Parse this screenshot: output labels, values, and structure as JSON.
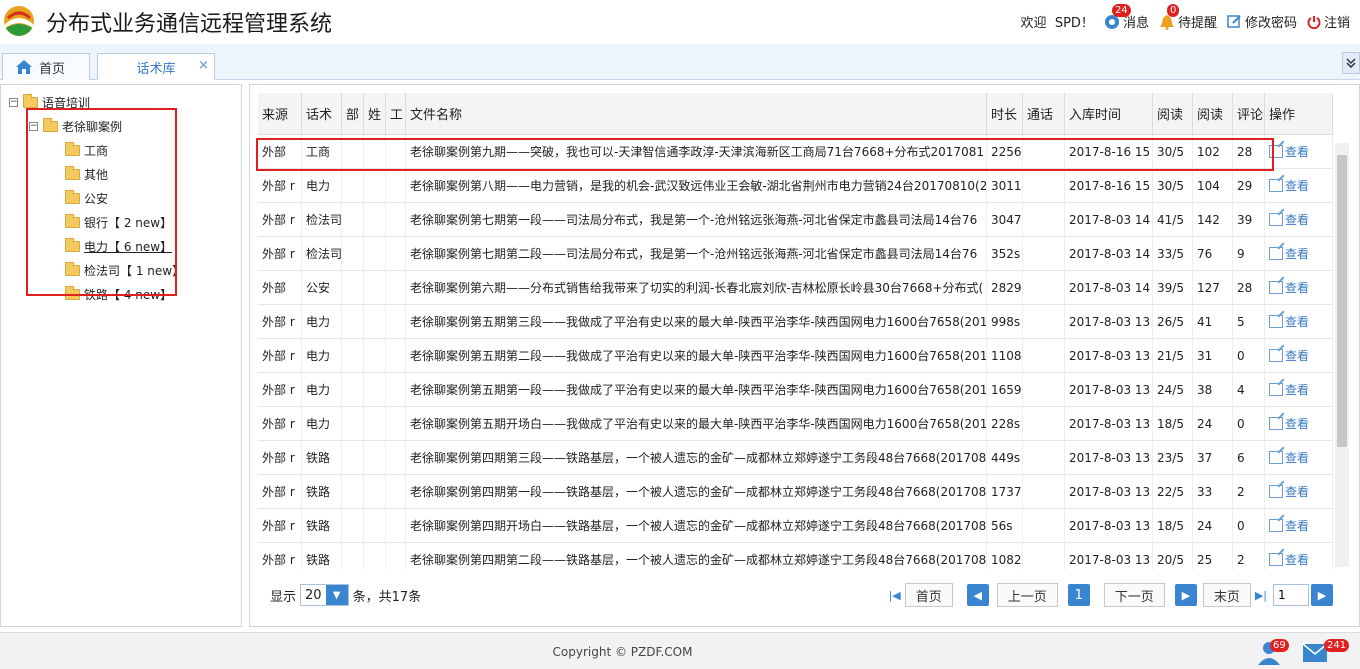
{
  "header": {
    "title": "分布式业务通信远程管理系统",
    "welcome": "欢迎",
    "user": "SPD！",
    "messages_label": "消息",
    "messages_count": "24",
    "reminders_label": "待提醒",
    "reminders_count": "0",
    "change_password": "修改密码",
    "logout": "注销"
  },
  "tabs": {
    "home": "首页",
    "library": "话术库",
    "close": "×"
  },
  "tree": {
    "root": "语音培训",
    "group": "老徐聊案例",
    "items": [
      "工商",
      "其他",
      "公安",
      "银行【 2 new】",
      "电力【 6 new】",
      "检法司【 1 new】",
      "铁路【 4 new】"
    ]
  },
  "grid": {
    "headers": [
      "来源",
      "话术",
      "部",
      "姓",
      "工",
      "文件名称",
      "时长",
      "通话",
      "入库时间",
      "阅读",
      "阅读",
      "评论",
      "操作"
    ],
    "op_label": "查看",
    "rows": [
      {
        "src": "外部",
        "cat": "工商",
        "file": "老徐聊案例第九期——突破，我也可以-天津智信通李政淳-天津滨海新区工商局71台7668+分布式2017081",
        "dur": "2256",
        "date": "2017-8-16 15",
        "read": "30/5",
        "rc": "102",
        "cm": "28"
      },
      {
        "src": "外部 r",
        "cat": "电力",
        "file": "老徐聊案例第八期——电力营销，是我的机会-武汉致远伟业王会敏-湖北省荆州市电力营销24台20170810(2",
        "dur": "3011",
        "date": "2017-8-16 15",
        "read": "30/5",
        "rc": "104",
        "cm": "29"
      },
      {
        "src": "外部 r",
        "cat": "检法司",
        "file": "老徐聊案例第七期第一段——司法局分布式，我是第一个-沧州铭远张海燕-河北省保定市蠡县司法局14台76",
        "dur": "3047",
        "date": "2017-8-03 14",
        "read": "41/5",
        "rc": "142",
        "cm": "39"
      },
      {
        "src": "外部 r",
        "cat": "检法司",
        "file": "老徐聊案例第七期第二段——司法局分布式，我是第一个-沧州铭远张海燕-河北省保定市蠡县司法局14台76",
        "dur": "352s",
        "date": "2017-8-03 14",
        "read": "33/5",
        "rc": "76",
        "cm": "9"
      },
      {
        "src": "外部",
        "cat": "公安",
        "file": "老徐聊案例第六期——分布式销售给我带来了切实的利润-长春北宸刘欣-吉林松原长岭县30台7668+分布式(",
        "dur": "2829",
        "date": "2017-8-03 14",
        "read": "39/5",
        "rc": "127",
        "cm": "28"
      },
      {
        "src": "外部 r",
        "cat": "电力",
        "file": "老徐聊案例第五期第三段——我做成了平治有史以来的最大单-陕西平治李华-陕西国网电力1600台7658(201",
        "dur": "998s",
        "date": "2017-8-03 13",
        "read": "26/5",
        "rc": "41",
        "cm": "5"
      },
      {
        "src": "外部 r",
        "cat": "电力",
        "file": "老徐聊案例第五期第二段——我做成了平治有史以来的最大单-陕西平治李华-陕西国网电力1600台7658(201",
        "dur": "1108",
        "date": "2017-8-03 13",
        "read": "21/5",
        "rc": "31",
        "cm": "0"
      },
      {
        "src": "外部 r",
        "cat": "电力",
        "file": "老徐聊案例第五期第一段——我做成了平治有史以来的最大单-陕西平治李华-陕西国网电力1600台7658(201",
        "dur": "1659",
        "date": "2017-8-03 13",
        "read": "24/5",
        "rc": "38",
        "cm": "4"
      },
      {
        "src": "外部 r",
        "cat": "电力",
        "file": "老徐聊案例第五期开场白——我做成了平治有史以来的最大单-陕西平治李华-陕西国网电力1600台7658(201",
        "dur": "228s",
        "date": "2017-8-03 13",
        "read": "18/5",
        "rc": "24",
        "cm": "0"
      },
      {
        "src": "外部 r",
        "cat": "铁路",
        "file": "老徐聊案例第四期第三段——铁路基层，一个被人遗忘的金矿—成都林立郑婷遂宁工务段48台7668(201708",
        "dur": "449s",
        "date": "2017-8-03 13",
        "read": "23/5",
        "rc": "37",
        "cm": "6"
      },
      {
        "src": "外部 r",
        "cat": "铁路",
        "file": "老徐聊案例第四期第一段——铁路基层，一个被人遗忘的金矿—成都林立郑婷遂宁工务段48台7668(201708",
        "dur": "1737",
        "date": "2017-8-03 13",
        "read": "22/5",
        "rc": "33",
        "cm": "2"
      },
      {
        "src": "外部 r",
        "cat": "铁路",
        "file": "老徐聊案例第四期开场白——铁路基层，一个被人遗忘的金矿—成都林立郑婷遂宁工务段48台7668(201708",
        "dur": "56s",
        "date": "2017-8-03 13",
        "read": "18/5",
        "rc": "24",
        "cm": "0"
      },
      {
        "src": "外部 r",
        "cat": "铁路",
        "file": "老徐聊案例第四期第二段——铁路基层，一个被人遗忘的金矿—成都林立郑婷遂宁工务段48台7668(201708",
        "dur": "1082",
        "date": "2017-8-03 13",
        "read": "20/5",
        "rc": "25",
        "cm": "2"
      }
    ]
  },
  "pager": {
    "show_label": "显示",
    "page_size": "20",
    "total_label": "条，共17条",
    "first": "首页",
    "prev": "上一页",
    "current": "1",
    "next": "下一页",
    "last": "末页",
    "goto_value": "1"
  },
  "footer": {
    "copyright": "Copyright © PZDF.COM",
    "user_count": "69",
    "mail_count": "241"
  },
  "colors": {
    "accent": "#3a85d0",
    "highlight": "#e02020"
  }
}
